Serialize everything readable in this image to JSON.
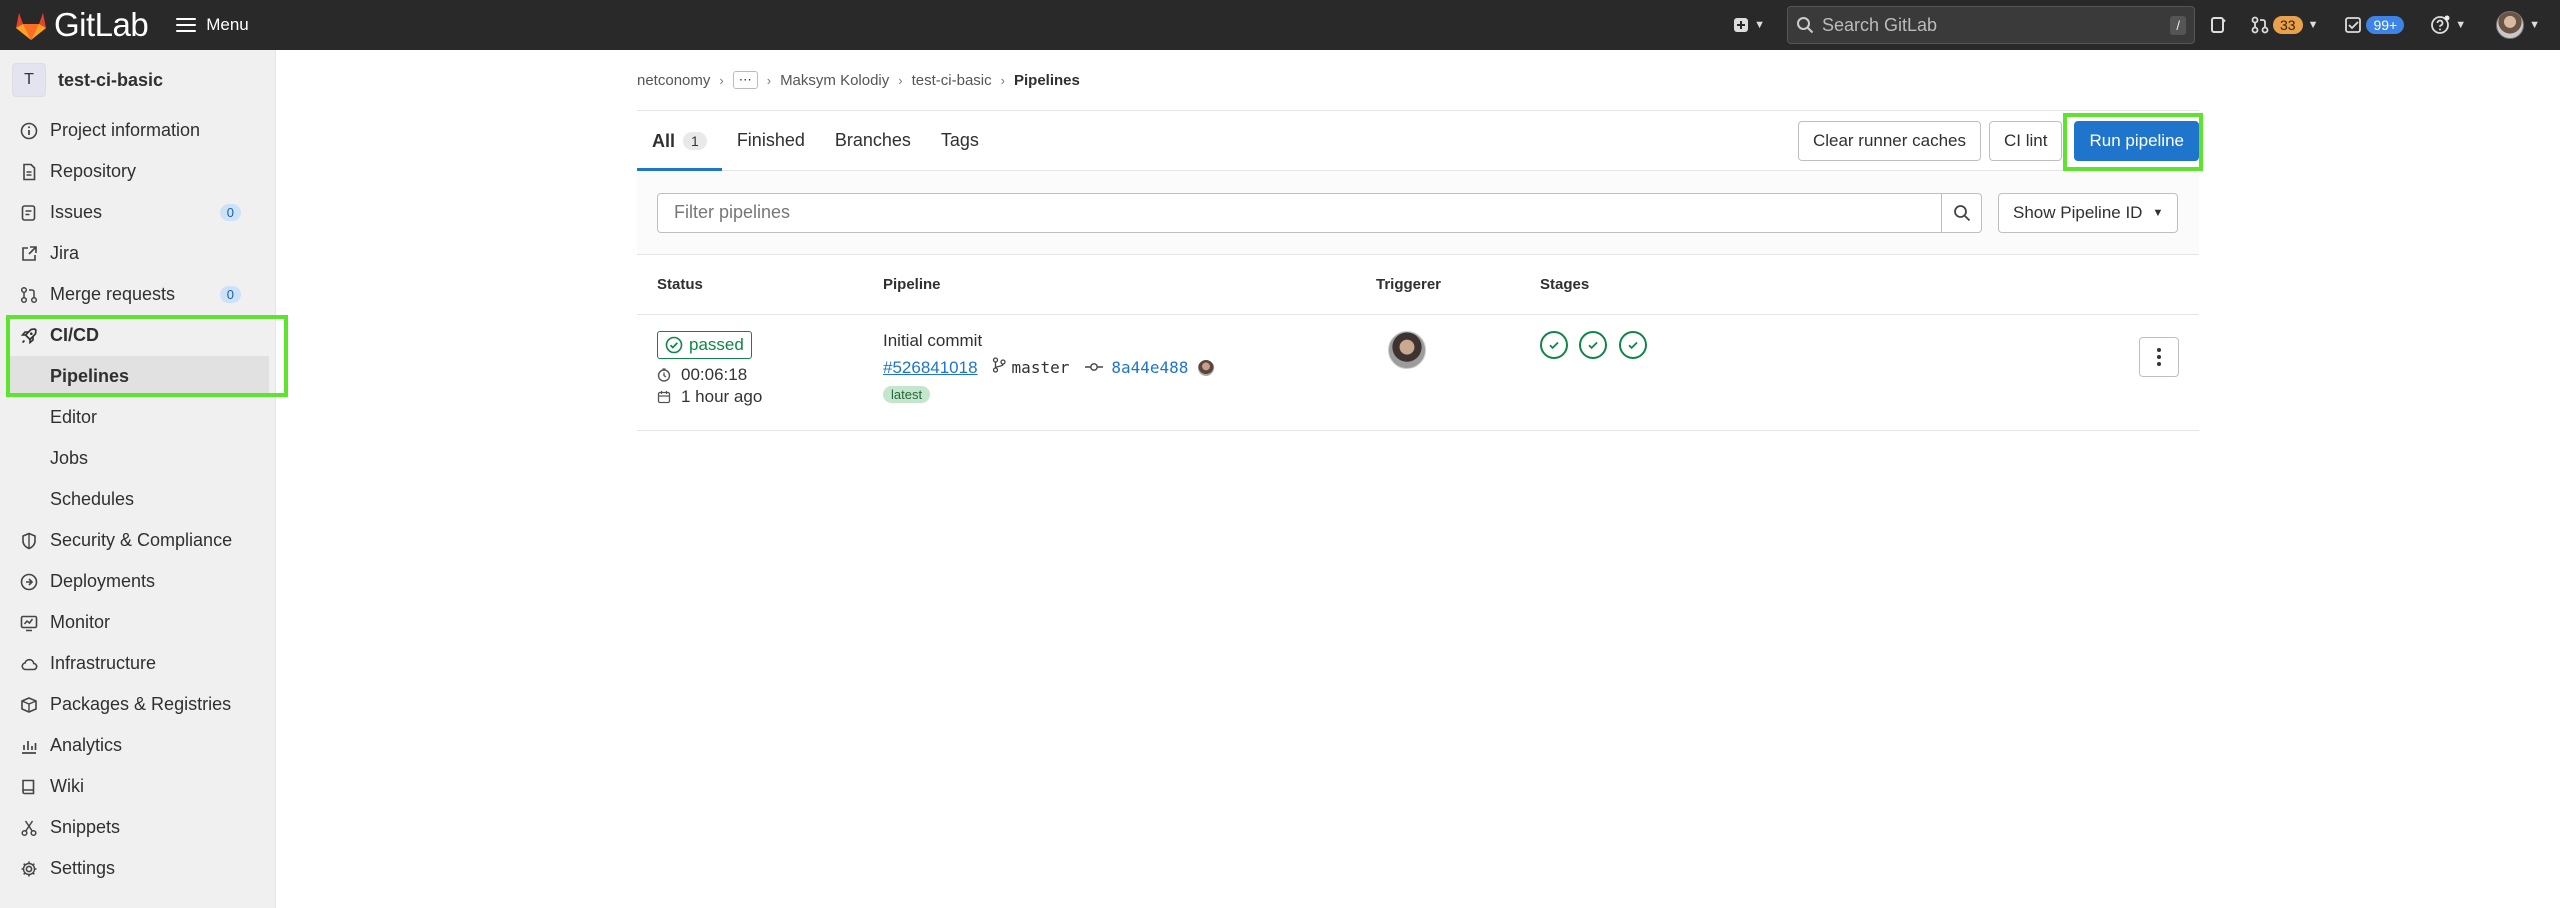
{
  "topbar": {
    "brand": "GitLab",
    "menu_label": "Menu",
    "search_placeholder": "Search GitLab",
    "search_shortcut": "/",
    "merge_requests_count": "33",
    "todos_count": "99+"
  },
  "sidebar": {
    "project_initial": "T",
    "project_name": "test-ci-basic",
    "items": [
      {
        "label": "Project information",
        "icon": "info-icon"
      },
      {
        "label": "Repository",
        "icon": "doc-icon"
      },
      {
        "label": "Issues",
        "icon": "issues-icon",
        "count": "0"
      },
      {
        "label": "Jira",
        "icon": "external-link-icon"
      },
      {
        "label": "Merge requests",
        "icon": "merge-request-icon",
        "count": "0"
      },
      {
        "label": "CI/CD",
        "icon": "rocket-icon"
      }
    ],
    "cicd_sub": [
      "Pipelines",
      "Editor",
      "Jobs",
      "Schedules"
    ],
    "items_after": [
      {
        "label": "Security & Compliance",
        "icon": "shield-icon"
      },
      {
        "label": "Deployments",
        "icon": "deployments-icon"
      },
      {
        "label": "Monitor",
        "icon": "monitor-icon"
      },
      {
        "label": "Infrastructure",
        "icon": "cloud-icon"
      },
      {
        "label": "Packages & Registries",
        "icon": "package-icon"
      },
      {
        "label": "Analytics",
        "icon": "chart-icon"
      },
      {
        "label": "Wiki",
        "icon": "book-icon"
      },
      {
        "label": "Snippets",
        "icon": "scissors-icon"
      },
      {
        "label": "Settings",
        "icon": "gear-icon"
      }
    ]
  },
  "breadcrumb": {
    "group": "netconomy",
    "user": "Maksym Kolodiy",
    "project": "test-ci-basic",
    "current": "Pipelines"
  },
  "tabs": {
    "all": "All",
    "all_count": "1",
    "finished": "Finished",
    "branches": "Branches",
    "tags": "Tags"
  },
  "actions": {
    "clear_caches": "Clear runner caches",
    "ci_lint": "CI lint",
    "run_pipeline": "Run pipeline"
  },
  "filter": {
    "placeholder": "Filter pipelines",
    "sort_label": "Show Pipeline ID"
  },
  "table": {
    "headers": {
      "status": "Status",
      "pipeline": "Pipeline",
      "triggerer": "Triggerer",
      "stages": "Stages"
    },
    "rows": [
      {
        "status": "passed",
        "duration": "00:06:18",
        "finished": "1 hour ago",
        "commit_title": "Initial commit",
        "pipeline_id": "#526841018",
        "branch": "master",
        "sha": "8a44e488",
        "tag": "latest",
        "stages": [
          "passed",
          "passed",
          "passed"
        ]
      }
    ]
  },
  "colors": {
    "accent": "#1f75cb",
    "success": "#108548",
    "highlight": "#5ee32e"
  }
}
